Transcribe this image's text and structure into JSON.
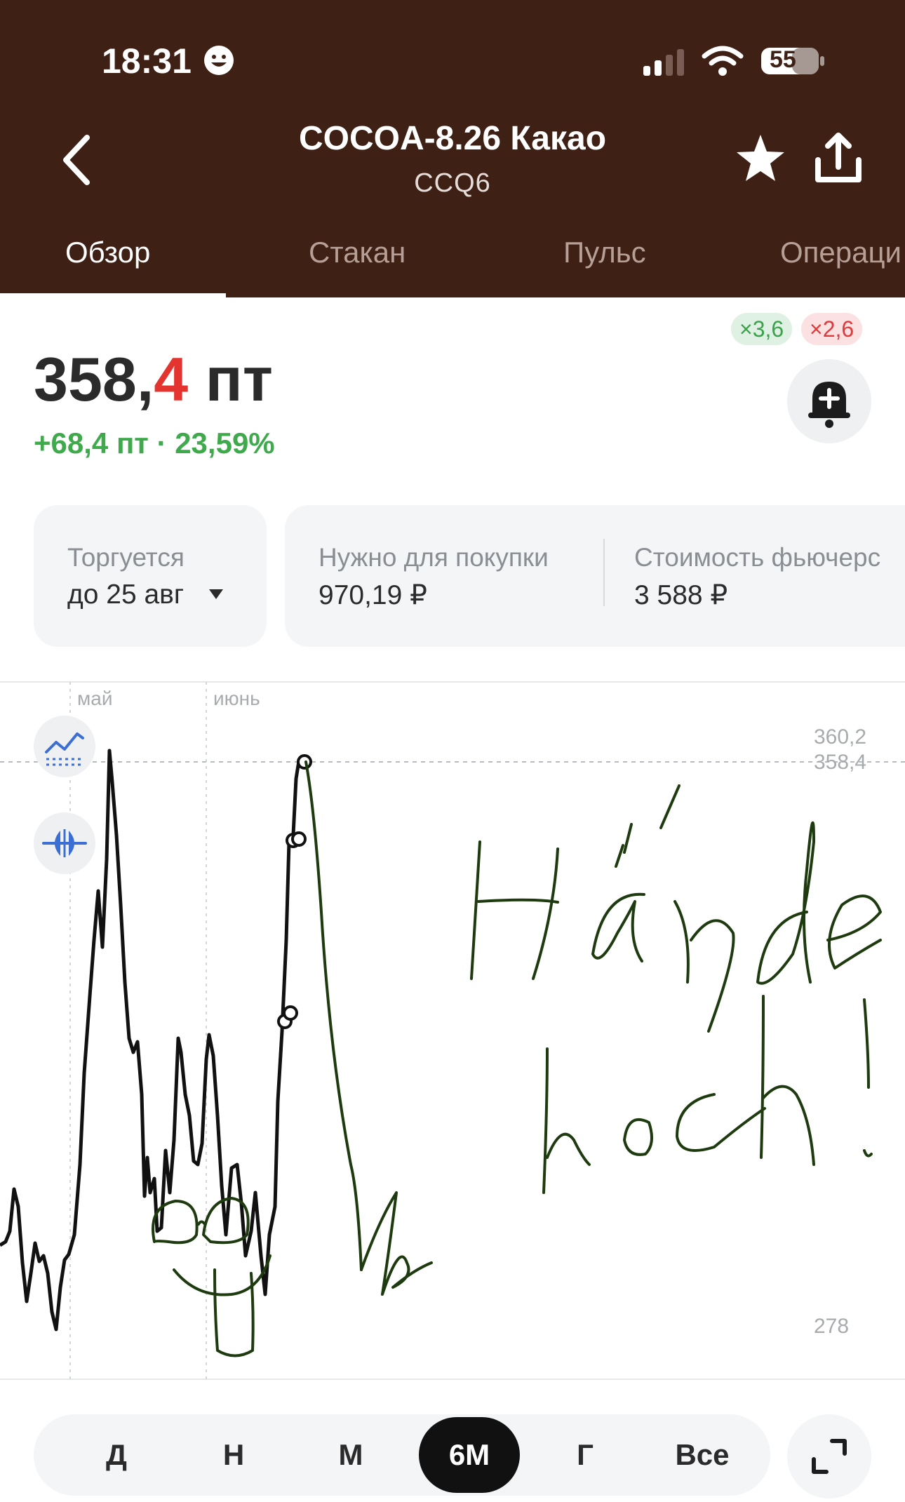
{
  "status": {
    "time": "18:31",
    "battery": "55"
  },
  "header": {
    "title": "COCOA-8.26 Какао",
    "ticker": "CCQ6",
    "tabs": [
      {
        "label": "Обзор",
        "active": true
      },
      {
        "label": "Стакан",
        "active": false
      },
      {
        "label": "Пульс",
        "active": false
      },
      {
        "label": "Операци",
        "active": false
      }
    ]
  },
  "badges": {
    "long": "×3,6",
    "short": "×2,6"
  },
  "price": {
    "int": "358,",
    "frac": "4",
    "unit": " пт",
    "change": "+68,4 пт · 23,59%"
  },
  "info": {
    "trading_label": "Торгуется",
    "trading_value": "до 25 авг",
    "buy_label": "Нужно для покупки",
    "buy_value": "970,19 ₽",
    "cost_label": "Стоимость фьючерс",
    "cost_value": "3 588 ₽"
  },
  "chart_data": {
    "type": "line",
    "x_ticks": [
      "май",
      "июнь"
    ],
    "y_ticks": [
      "360,2",
      "358,4",
      "278"
    ],
    "current_value": 358.4,
    "handwritten_text": "Hände hoch!"
  },
  "periods": [
    {
      "label": "Д",
      "active": false
    },
    {
      "label": "Н",
      "active": false
    },
    {
      "label": "М",
      "active": false
    },
    {
      "label": "6М",
      "active": true
    },
    {
      "label": "Г",
      "active": false
    },
    {
      "label": "Все",
      "active": false
    }
  ],
  "colors": {
    "header_bg": "#3e2015",
    "positive": "#3faa4c",
    "negative": "#e3342f",
    "drawing": "#1e3a0f"
  }
}
